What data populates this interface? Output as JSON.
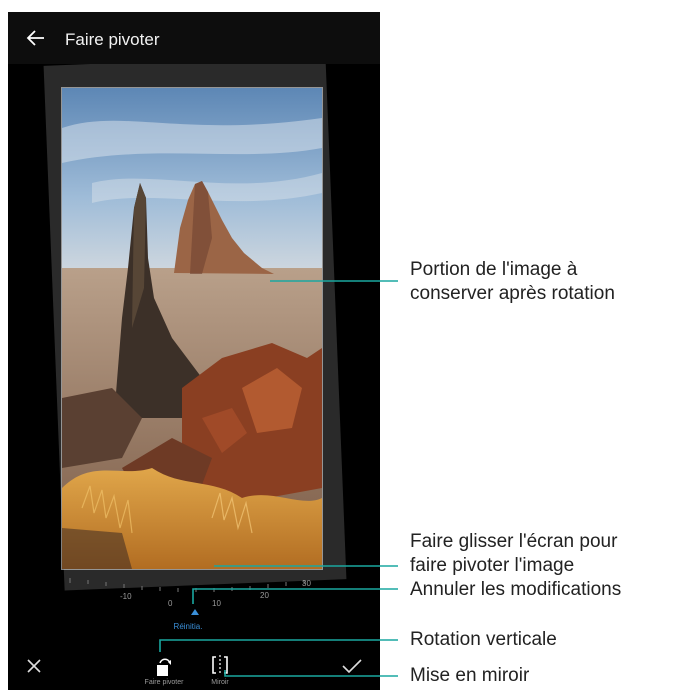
{
  "header": {
    "title": "Faire pivoter",
    "back_icon": "arrow-left-icon"
  },
  "dial": {
    "ticks": [
      "-10",
      "0",
      "10",
      "20",
      "30"
    ],
    "reset_label": "Réinitia."
  },
  "toolbar": {
    "rotate_label": "Faire pivoter",
    "mirror_label": "Miroir",
    "close_icon": "close-icon",
    "confirm_icon": "check-icon"
  },
  "callouts": {
    "crop_line1": "Portion de l'image à",
    "crop_line2": "conserver après rotation",
    "drag_line1": "Faire glisser l'écran pour",
    "drag_line2": "faire pivoter l'image",
    "reset": "Annuler les modifications",
    "rotate": "Rotation verticale",
    "mirror": "Mise en miroir"
  },
  "colors": {
    "accent": "#3a8fd8",
    "leader_line": "#1aa7a0",
    "screen_bg": "#000000"
  }
}
